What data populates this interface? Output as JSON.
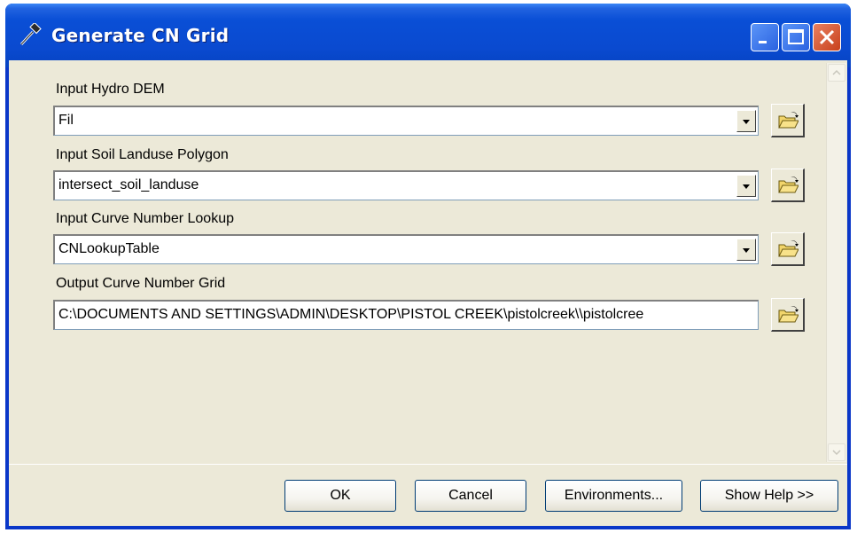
{
  "window": {
    "title": "Generate CN Grid",
    "title_icon": "hammer-icon",
    "controls": [
      "minimize-icon",
      "maximize-icon",
      "close-icon"
    ]
  },
  "fields": [
    {
      "label": "Input Hydro DEM",
      "value": "Fil",
      "type": "combo"
    },
    {
      "label": "Input Soil Landuse Polygon",
      "value": "intersect_soil_landuse",
      "type": "combo"
    },
    {
      "label": "Input Curve Number Lookup",
      "value": "CNLookupTable",
      "type": "combo"
    },
    {
      "label": "Output Curve Number Grid",
      "value": "C:\\DOCUMENTS AND SETTINGS\\ADMIN\\DESKTOP\\PISTOL CREEK\\pistolcreek\\\\pistolcree",
      "type": "text"
    }
  ],
  "buttons": {
    "ok": "OK",
    "cancel": "Cancel",
    "environments": "Environments...",
    "show_help": "Show Help >>"
  },
  "colors": {
    "titlebar": "#0a4fd6",
    "dialog_bg": "#ece9d8",
    "close_button": "#c8401c"
  }
}
